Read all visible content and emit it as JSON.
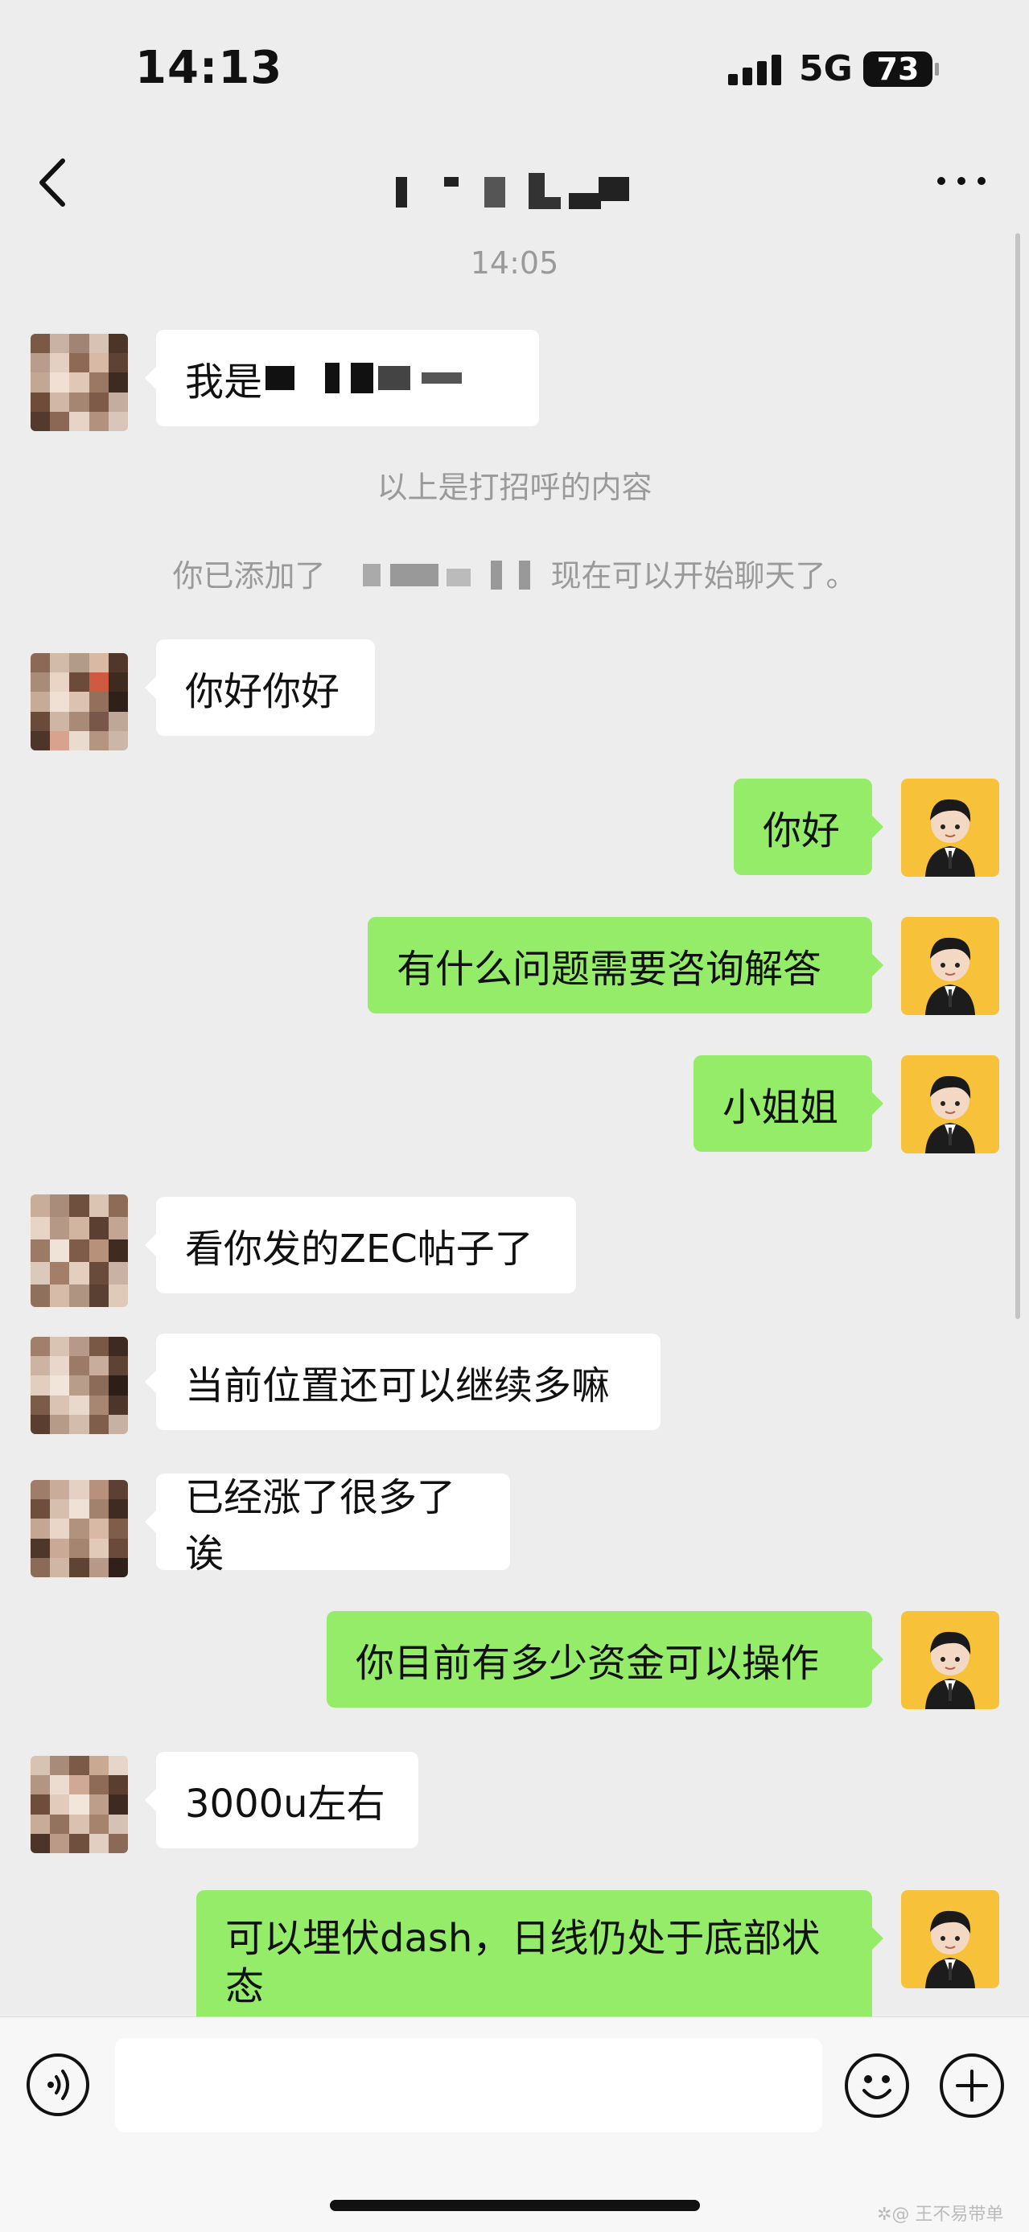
{
  "status_bar": {
    "time": "14:13",
    "network": "5G",
    "battery": "73"
  },
  "nav": {
    "back_icon": "chevron-left-icon",
    "more_icon": "more-icon"
  },
  "chat": {
    "timestamp": "14:05",
    "greeting_prefix": "我是",
    "system_greeting": "以上是打招呼的内容",
    "system_added_prefix": "你已添加了",
    "system_added_suffix": "现在可以开始聊天了。",
    "messages": [
      {
        "side": "left",
        "text": "你好你好"
      },
      {
        "side": "right",
        "text": "你好"
      },
      {
        "side": "right",
        "text": "有什么问题需要咨询解答"
      },
      {
        "side": "right",
        "text": "小姐姐"
      },
      {
        "side": "left",
        "text": "看你发的ZEC帖子了"
      },
      {
        "side": "left",
        "text": "当前位置还可以继续多嘛"
      },
      {
        "side": "left",
        "text": "已经涨了很多了诶"
      },
      {
        "side": "right",
        "text": "你目前有多少资金可以操作"
      },
      {
        "side": "left",
        "text": "3000u左右"
      },
      {
        "side": "right",
        "text": "可以埋伏dash，日线仍处于底部状态"
      }
    ]
  },
  "input_bar": {
    "placeholder": "",
    "voice_icon": "voice-icon",
    "emoji_icon": "emoji-icon",
    "plus_icon": "plus-icon"
  },
  "watermark": "✲@ 王不易带单",
  "colors": {
    "background": "#ededed",
    "sent_bubble": "#95ec69",
    "received_bubble": "#ffffff",
    "avatar_bg": "#f7c23a"
  }
}
